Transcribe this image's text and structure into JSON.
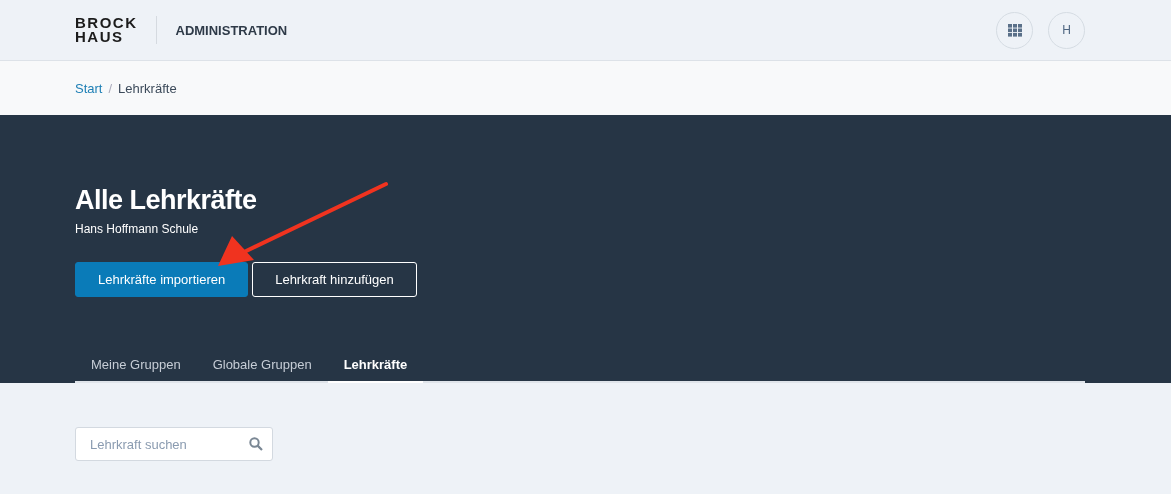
{
  "header": {
    "logo": [
      "BROCK",
      "HAUS"
    ],
    "title": "ADMINISTRATION",
    "avatar": "H"
  },
  "breadcrumb": {
    "separator": "/",
    "items": [
      {
        "label": "Start",
        "kind": "link"
      },
      {
        "label": "Lehrkräfte",
        "kind": "current"
      }
    ]
  },
  "hero": {
    "title": "Alle Lehrkräfte",
    "subtitle": "Hans Hoffmann Schule",
    "buttons": [
      {
        "label": "Lehrkräfte importieren",
        "kind": "primary"
      },
      {
        "label": "Lehrkraft hinzufügen",
        "kind": "outline"
      }
    ],
    "tabs": [
      {
        "label": "Meine Gruppen",
        "selected": false
      },
      {
        "label": "Globale Gruppen",
        "selected": false
      },
      {
        "label": "Lehrkräfte",
        "selected": true
      }
    ]
  },
  "search": {
    "placeholder": "Lehrkraft suchen"
  }
}
